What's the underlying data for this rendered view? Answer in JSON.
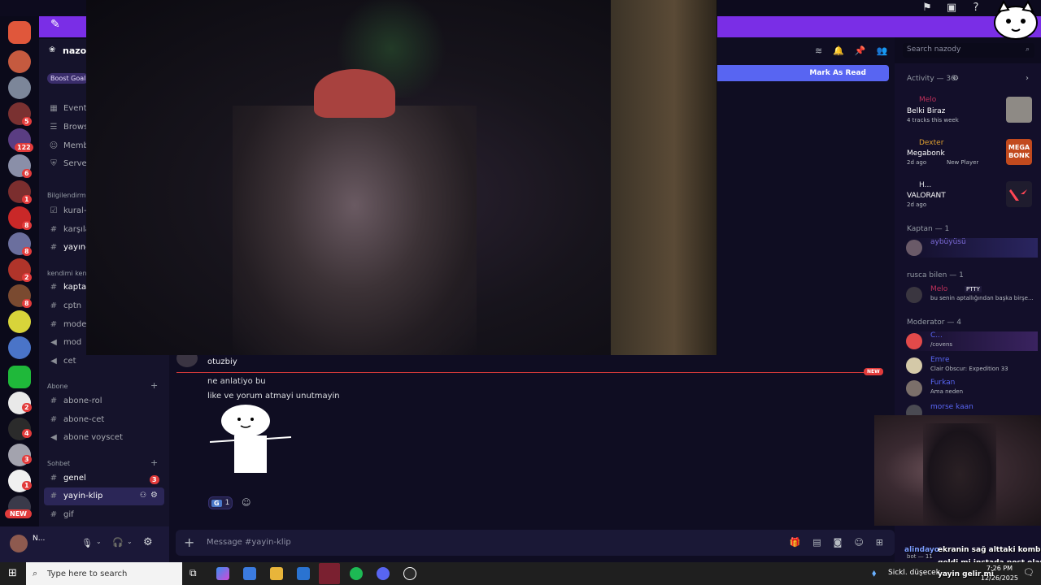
{
  "server": {
    "name": "nazod",
    "boost_goal": "Boost Goal",
    "channels": [
      {
        "label": "Events",
        "icon": "calendar-icon"
      },
      {
        "label": "Brows",
        "icon": "browse-icon"
      },
      {
        "label": "Memb",
        "icon": "members-icon"
      },
      {
        "label": "Server",
        "icon": "shield-icon"
      }
    ],
    "category_info": "Bilgilendirm",
    "info_channels": [
      "kural-",
      "karşıla",
      "yayın-"
    ],
    "category_self": "kendimi ken",
    "self_channels": [
      "kaptar",
      "cptn",
      "moder",
      "mod",
      "cet"
    ],
    "category_abone": "Abone",
    "abone_channels": [
      "abone-rol",
      "abone-cet",
      "abone voyscet"
    ],
    "category_sohbet": "Sohbet",
    "sohbet_channels": [
      "genel",
      "yayin-klip",
      "gif"
    ],
    "genel_badge": "3"
  },
  "rail_badges": [
    "5",
    "122",
    "6",
    "1",
    "8",
    "8",
    "2",
    "8",
    "2",
    "4",
    "3",
    "1"
  ],
  "rail_new": "NEW",
  "user": {
    "name": "N..."
  },
  "header": {
    "search_placeholder": "Search nazody",
    "mark_as_read": "Mark As Read"
  },
  "messages": {
    "author": "otuzbiy",
    "new_tag": "NEW",
    "lines": [
      "ne anlatiyo bu",
      "like ve yorum atmayi unutmayin"
    ],
    "reaction_count": "1",
    "reaction_letter": "G"
  },
  "composer": {
    "placeholder": "Message #yayin-klip"
  },
  "activity": {
    "header": "Activity — 36",
    "items": [
      {
        "user": "Melo",
        "title": "Belki Biraz",
        "sub": "4 tracks this week",
        "user_color": "#c0305a"
      },
      {
        "user": "Dexter",
        "title": "Megabonk",
        "sub": "2d ago",
        "sub2": "New Player",
        "user_color": "#e0a030",
        "thumb": "MEGA BONK"
      },
      {
        "user": "H...",
        "title": "VALORANT",
        "sub": "2d ago",
        "user_color": "#dbdee1"
      }
    ]
  },
  "members": {
    "kaptan_header": "Kaptan — 1",
    "kaptan": [
      {
        "name": "aybüyüsü",
        "status": "",
        "color": "#7c6ad8"
      }
    ],
    "rusca_header": "rusca bilen — 1",
    "rusca": [
      {
        "name": "Melo",
        "tag": "PTTY",
        "status": "bu senin aptallığından başka birşe...",
        "color": "#c0305a"
      }
    ],
    "moderator_header": "Moderator — 4",
    "moderators": [
      {
        "name": "C...",
        "status": "/covens",
        "color": "#5865f2"
      },
      {
        "name": "Emre",
        "status": "Clair Obscur: Expedition 33",
        "color": "#5865f2"
      },
      {
        "name": "Furkan",
        "status": "Ama neden",
        "color": "#5865f2"
      },
      {
        "name": "morse kaan",
        "status": "",
        "color": "#5865f2"
      }
    ]
  },
  "stream_overlay": {
    "lines": [
      {
        "user": "alindayo",
        "text": "ekranin sağ alttaki kombinle e"
      },
      {
        "user": "",
        "text": "geldi mi instada post olarak g"
      },
      {
        "user": "",
        "text": "yayin gelir mi"
      }
    ],
    "bot_label": "bot — 11"
  },
  "taskbar": {
    "search_placeholder": "Type here to search",
    "tray_text": "Sickl. düşecek",
    "time": "7:26 PM",
    "date": "12/26/2025"
  }
}
